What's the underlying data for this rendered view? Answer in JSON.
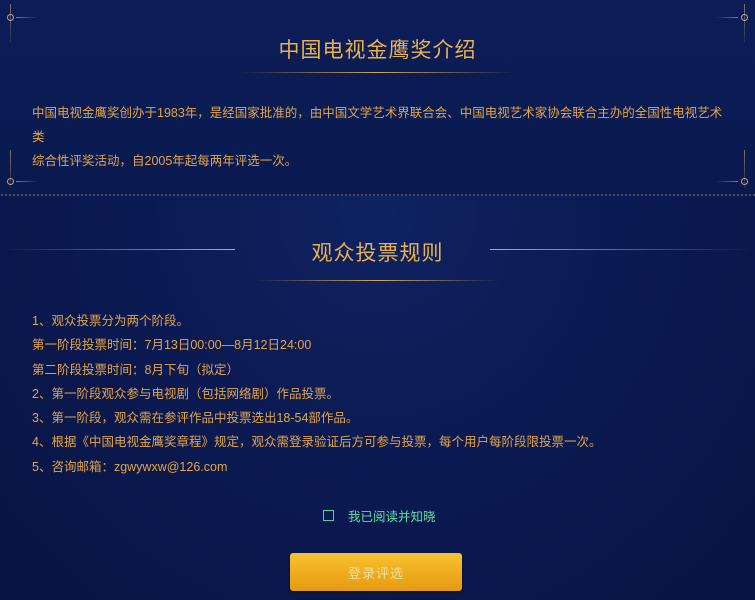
{
  "intro": {
    "title": "中国电视金鹰奖介绍",
    "text_line1": "中国电视金鹰奖创办于1983年，是经国家批准的，由中国文学艺术界联合会、中国电视艺术家协会联合主办的全国性电视艺术类",
    "text_line2": "综合性评奖活动，自2005年起每两年评选一次。"
  },
  "rules": {
    "title": "观众投票规则",
    "items": [
      "1、观众投票分为两个阶段。",
      "第一阶段投票时间：7月13日00:00—8月12日24:00",
      "第二阶段投票时间：8月下旬（拟定）",
      "2、第一阶段观众参与电视剧（包括网络剧）作品投票。",
      "3、第一阶段，观众需在参评作品中投票选出18-54部作品。",
      "4、根据《中国电视金鹰奖章程》规定，观众需登录验证后方可参与投票，每个用户每阶段限投票一次。",
      "5、咨询邮箱：zgwywxw@126.com"
    ]
  },
  "agree": {
    "label": "我已阅读并知晓",
    "checked": false
  },
  "login_button": {
    "label": "登录评选"
  },
  "colors": {
    "background": "#0a1849",
    "gold_text": "#e4a546",
    "agree_green": "#5ee0a6",
    "button_gold": "#eeab1c"
  }
}
